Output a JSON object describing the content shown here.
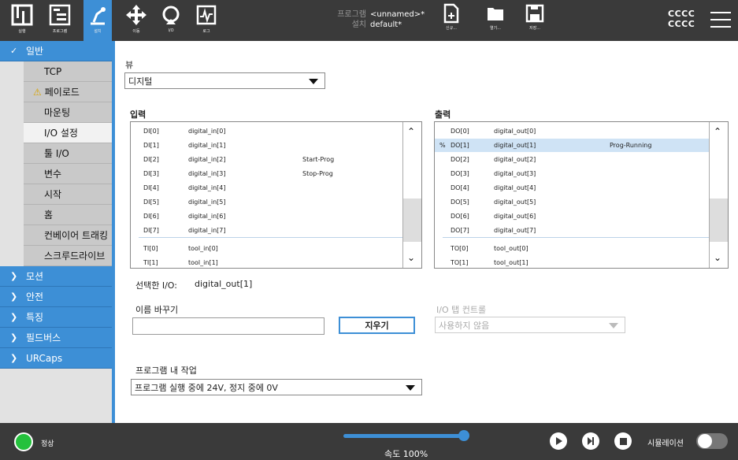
{
  "topbar": {
    "nav": [
      {
        "label": "실행",
        "icon": "ur-logo-icon"
      },
      {
        "label": "프로그램",
        "icon": "program-icon"
      },
      {
        "label": "설치",
        "icon": "installation-robot-icon"
      },
      {
        "label": "이동",
        "icon": "move-arrows-icon"
      },
      {
        "label": "I/O",
        "icon": "io-icon"
      },
      {
        "label": "로그",
        "icon": "log-icon"
      }
    ],
    "program_key": "프로그램",
    "program_value": "<unnamed>*",
    "install_key": "설치",
    "install_value": "default*",
    "file_buttons": [
      {
        "label": "신규...",
        "icon": "new-file-icon"
      },
      {
        "label": "열기...",
        "icon": "open-folder-icon"
      },
      {
        "label": "저장...",
        "icon": "save-icon"
      }
    ],
    "user_line1": "CCCC",
    "user_line2": "CCCC"
  },
  "sidebar": {
    "general": "일반",
    "items": [
      "TCP",
      "페이로드",
      "마운팅",
      "I/O 설정",
      "툴 I/O",
      "변수",
      "시작",
      "홈",
      "컨베이어 트래킹",
      "스크루드라이브"
    ],
    "selected_index": 3,
    "warning_index": 1,
    "sections": [
      "모션",
      "안전",
      "특징",
      "필드버스",
      "URCaps"
    ]
  },
  "main": {
    "view_label": "뷰",
    "view_value": "디지털",
    "input_title": "입력",
    "output_title": "출력",
    "inputs": [
      {
        "id": "DI[0]",
        "name": "digital_in[0]",
        "func": ""
      },
      {
        "id": "DI[1]",
        "name": "digital_in[1]",
        "func": ""
      },
      {
        "id": "DI[2]",
        "name": "digital_in[2]",
        "func": "Start-Prog"
      },
      {
        "id": "DI[3]",
        "name": "digital_in[3]",
        "func": "Stop-Prog"
      },
      {
        "id": "DI[4]",
        "name": "digital_in[4]",
        "func": ""
      },
      {
        "id": "DI[5]",
        "name": "digital_in[5]",
        "func": ""
      },
      {
        "id": "DI[6]",
        "name": "digital_in[6]",
        "func": ""
      },
      {
        "id": "DI[7]",
        "name": "digital_in[7]",
        "func": ""
      },
      {
        "id": "TI[0]",
        "name": "tool_in[0]",
        "func": ""
      },
      {
        "id": "TI[1]",
        "name": "tool_in[1]",
        "func": ""
      }
    ],
    "outputs": [
      {
        "prefix": "",
        "id": "DO[0]",
        "name": "digital_out[0]",
        "func": ""
      },
      {
        "prefix": "%",
        "id": "DO[1]",
        "name": "digital_out[1]",
        "func": "Prog-Running"
      },
      {
        "prefix": "",
        "id": "DO[2]",
        "name": "digital_out[2]",
        "func": ""
      },
      {
        "prefix": "",
        "id": "DO[3]",
        "name": "digital_out[3]",
        "func": ""
      },
      {
        "prefix": "",
        "id": "DO[4]",
        "name": "digital_out[4]",
        "func": ""
      },
      {
        "prefix": "",
        "id": "DO[5]",
        "name": "digital_out[5]",
        "func": ""
      },
      {
        "prefix": "",
        "id": "DO[6]",
        "name": "digital_out[6]",
        "func": ""
      },
      {
        "prefix": "",
        "id": "DO[7]",
        "name": "digital_out[7]",
        "func": ""
      },
      {
        "prefix": "",
        "id": "TO[0]",
        "name": "tool_out[0]",
        "func": ""
      },
      {
        "prefix": "",
        "id": "TO[1]",
        "name": "tool_out[1]",
        "func": ""
      }
    ],
    "selected_label": "선택한 I/O:",
    "selected_value": "digital_out[1]",
    "rename_label": "이름 바꾸기",
    "clear_button": "지우기",
    "tab_control_label": "I/O 탭 컨트롤",
    "tab_control_value": "사용하지 않음",
    "action_label": "프로그램 내 작업",
    "action_value": "프로그램 실행 중에 24V, 정지 중에 0V"
  },
  "bottombar": {
    "status": "정상",
    "speed": "속도 100%",
    "speed_fraction": 1.0,
    "simulation": "시뮬레이션",
    "colors": {
      "accent": "#3d8fd6",
      "ok": "#24c13c"
    }
  }
}
